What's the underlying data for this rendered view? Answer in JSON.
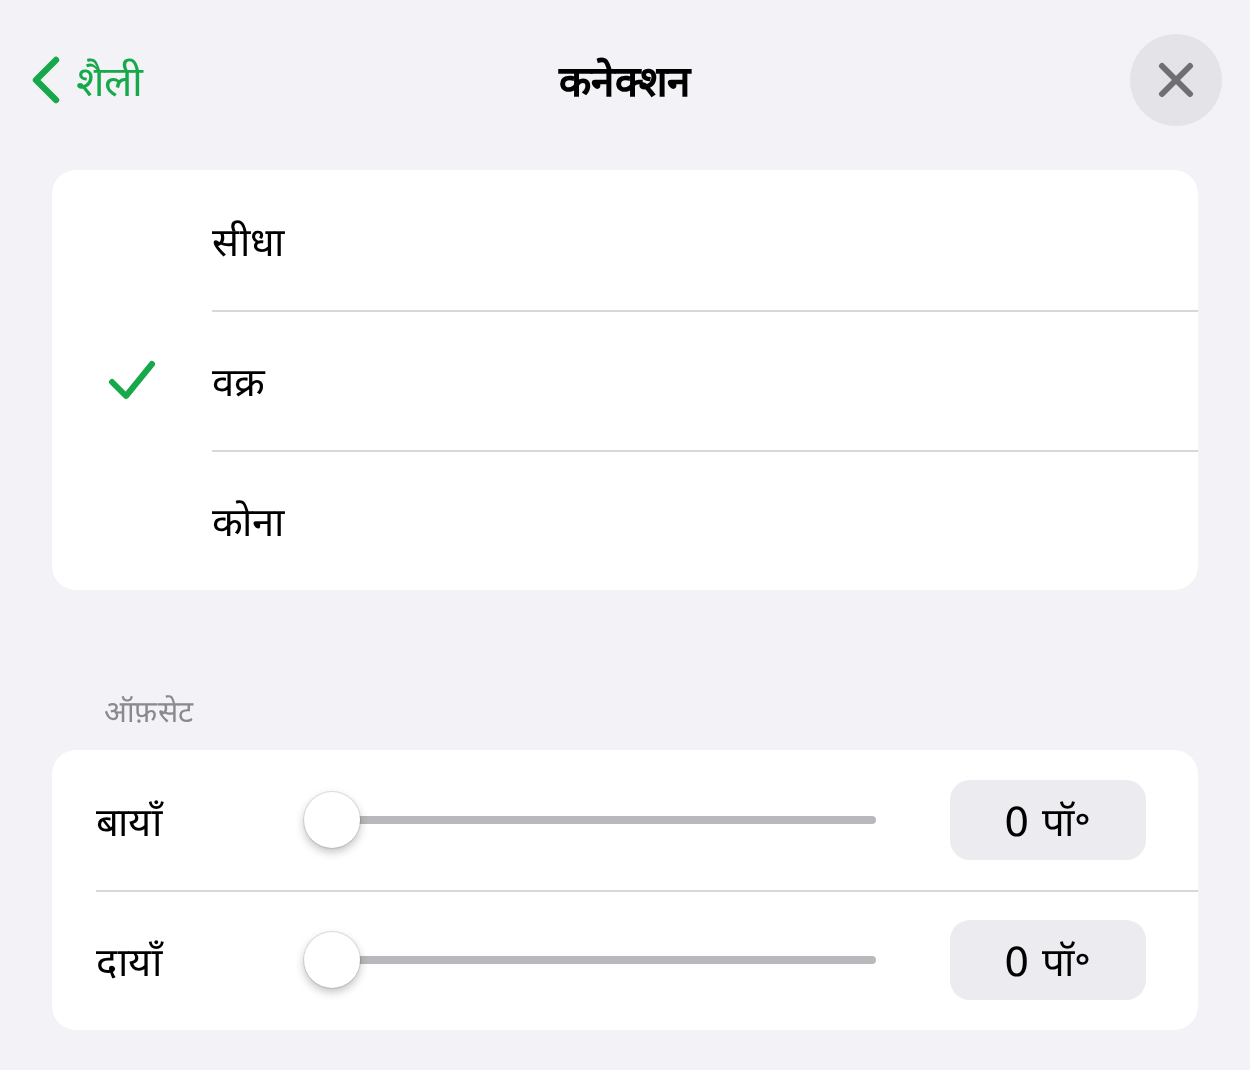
{
  "nav": {
    "back": "शैली",
    "title": "कनेक्शन"
  },
  "options": [
    {
      "label": "सीधा",
      "selected": false
    },
    {
      "label": "वक्र",
      "selected": true
    },
    {
      "label": "कोना",
      "selected": false
    }
  ],
  "offset": {
    "header": "ऑफ़सेट",
    "rows": [
      {
        "label": "बायाँ",
        "level": 0,
        "value": "0 पॉ॰"
      },
      {
        "label": "दायाँ",
        "level": 0,
        "value": "0 पॉ॰"
      }
    ]
  }
}
